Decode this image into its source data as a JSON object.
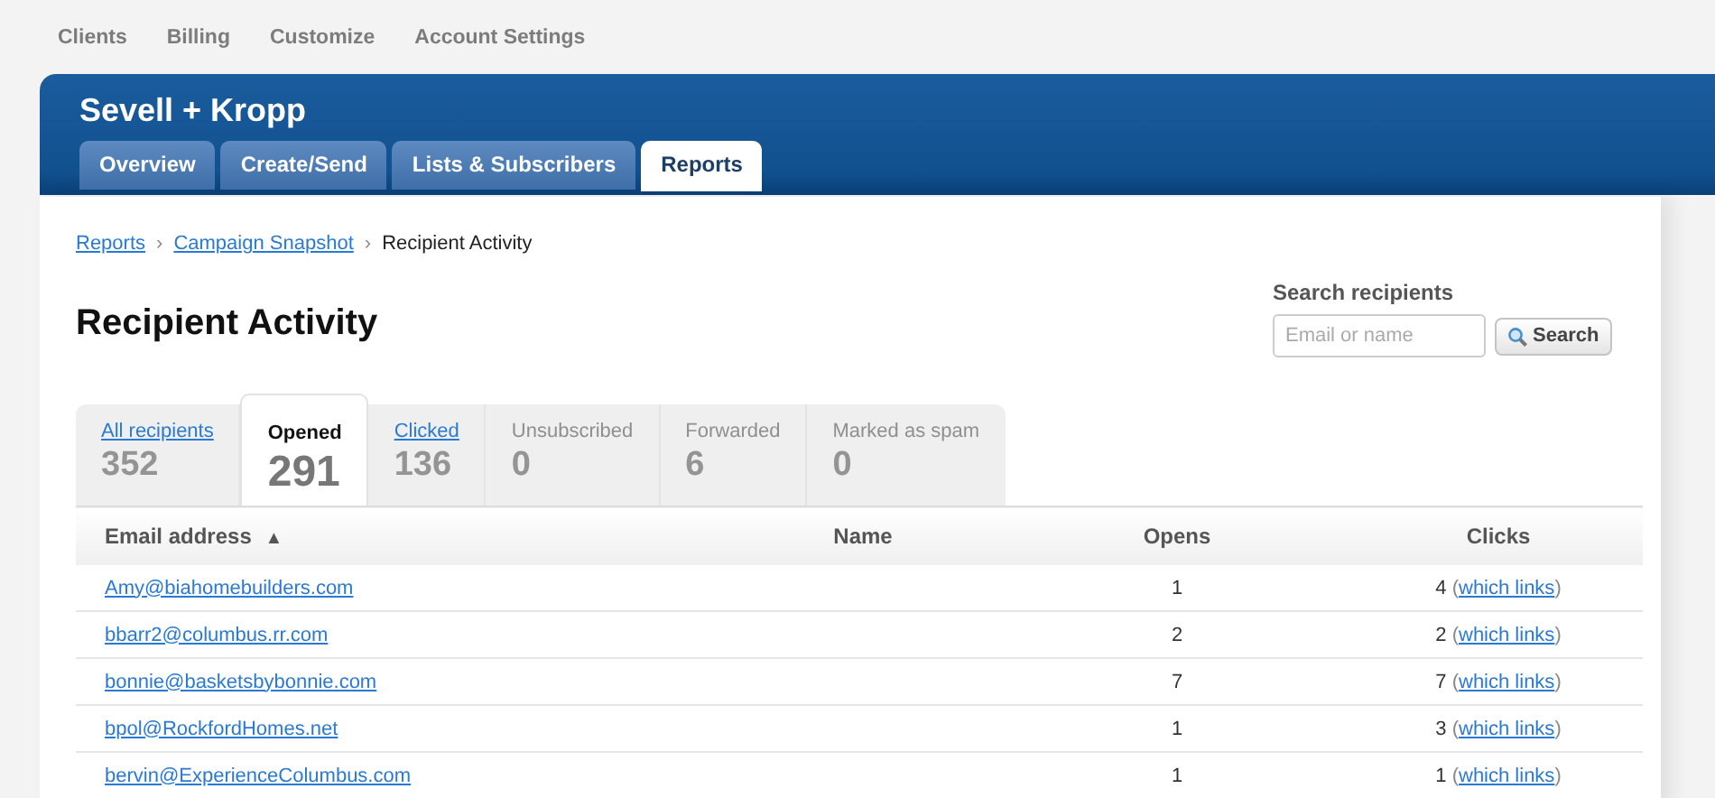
{
  "top_nav": [
    "Clients",
    "Billing",
    "Customize",
    "Account Settings"
  ],
  "header": {
    "title": "Sevell + Kropp",
    "tabs": [
      {
        "label": "Overview",
        "selected": false
      },
      {
        "label": "Create/Send",
        "selected": false
      },
      {
        "label": "Lists & Subscribers",
        "selected": false
      },
      {
        "label": "Reports",
        "selected": true
      }
    ]
  },
  "breadcrumb": {
    "links": [
      "Reports",
      "Campaign Snapshot"
    ],
    "separator": "›",
    "current": "Recipient Activity"
  },
  "heading": "Recipient Activity",
  "search": {
    "label": "Search recipients",
    "placeholder": "Email or name",
    "button": "Search"
  },
  "stat_tabs": [
    {
      "label": "All recipients",
      "count": "352",
      "selected": false,
      "disabled": false
    },
    {
      "label": "Opened",
      "count": "291",
      "selected": true,
      "disabled": false
    },
    {
      "label": "Clicked",
      "count": "136",
      "selected": false,
      "disabled": false
    },
    {
      "label": "Unsubscribed",
      "count": "0",
      "selected": false,
      "disabled": true
    },
    {
      "label": "Forwarded",
      "count": "6",
      "selected": false,
      "disabled": true
    },
    {
      "label": "Marked as spam",
      "count": "0",
      "selected": false,
      "disabled": true
    }
  ],
  "table": {
    "columns": [
      {
        "label": "Email address",
        "sort": "▲"
      },
      {
        "label": "Name"
      },
      {
        "label": "Opens"
      },
      {
        "label": "Clicks"
      }
    ],
    "rows": [
      {
        "email": "Amy@biahomebuilders.com",
        "opens": "1",
        "clicks": "4",
        "link_open": "(",
        "link": "which links",
        "link_close": ")"
      },
      {
        "email": "bbarr2@columbus.rr.com",
        "opens": "2",
        "clicks": "2",
        "link_open": "(",
        "link": "which links",
        "link_close": ")"
      },
      {
        "email": "bonnie@basketsbybonnie.com",
        "opens": "7",
        "clicks": "7",
        "link_open": "(",
        "link": "which links",
        "link_close": ")"
      },
      {
        "email": "bpol@RockfordHomes.net",
        "opens": "1",
        "clicks": "3",
        "link_open": "(",
        "link": "which links",
        "link_close": ")"
      },
      {
        "email": "bervin@ExperienceColumbus.com",
        "opens": "1",
        "clicks": "1",
        "link_open": "(",
        "link": "which links",
        "link_close": ")"
      }
    ]
  }
}
